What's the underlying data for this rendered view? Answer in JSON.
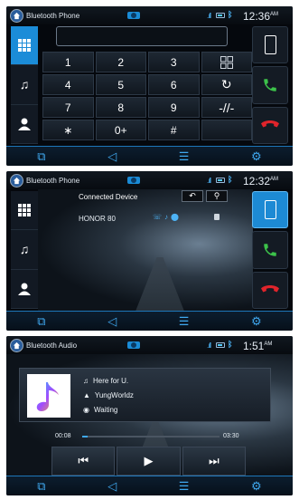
{
  "screen1": {
    "title": "Bluetooth Phone",
    "time": "12:36",
    "ampm": "AM",
    "keys": [
      "1",
      "2",
      "3",
      "4",
      "5",
      "6",
      "7",
      "8",
      "9",
      "∗",
      "0+",
      "#"
    ],
    "left_icons": [
      "keypad-icon",
      "music-icon",
      "contacts-icon"
    ],
    "right_icons": [
      "phone-device-icon",
      "call-icon",
      "hangup-icon"
    ]
  },
  "screen2": {
    "title": "Bluetooth Phone",
    "time": "12:32",
    "ampm": "AM",
    "connected_label": "Connected Device",
    "device": "HONOR 80"
  },
  "screen3": {
    "title": "Bluetooth Audio",
    "time": "1:51",
    "ampm": "AM",
    "track": "Here for U.",
    "artist": "YungWorldz",
    "status": "Waiting",
    "elapsed": "00:08",
    "duration": "03:30",
    "progress_fraction": 0.04
  },
  "colors": {
    "accent": "#1b8cd8",
    "call_green": "#3cc24a",
    "hangup_red": "#e0242b"
  }
}
